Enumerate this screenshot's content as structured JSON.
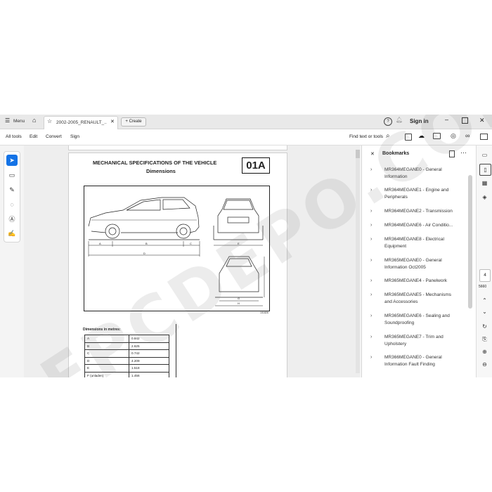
{
  "titlebar": {
    "menu_label": "Menu",
    "tab_title": "2002-2005_RENAULT_...",
    "create_label": "Create",
    "signin_label": "Sign in"
  },
  "toolbar": {
    "all_tools": "All tools",
    "edit": "Edit",
    "convert": "Convert",
    "sign": "Sign",
    "find": "Find text or tools"
  },
  "page": {
    "heading": "MECHANICAL SPECIFICATIONS OF THE VEHICLE",
    "subheading": "Dimensions",
    "section_code": "01A",
    "dim_labels": {
      "a": "A",
      "b": "B",
      "c": "C",
      "d": "D",
      "e": "E",
      "g": "G",
      "h": "H"
    },
    "drawing_ref": "101826",
    "table_title": "Dimensions in metres:",
    "table_rows": [
      {
        "label": "A",
        "value": "0.842"
      },
      {
        "label": "B",
        "value": "2.625"
      },
      {
        "label": "C",
        "value": "0.742"
      },
      {
        "label": "D",
        "value": "4.209"
      },
      {
        "label": "E",
        "value": "1.518"
      },
      {
        "label": "F (unladen)",
        "value": "1.456"
      }
    ]
  },
  "bookmarks": {
    "title": "Bookmarks",
    "items": [
      {
        "line1": "MR364MEGANE0 - General",
        "line2": "Information"
      },
      {
        "line1": "MR364MEGANE1 - Engine and",
        "line2": "Peripherals"
      },
      {
        "line1": "MR364MEGANE2 - Transmission",
        "line2": ""
      },
      {
        "line1": "MR364MEGANE6 - Air Conditio...",
        "line2": ""
      },
      {
        "line1": "MR364MEGANE8 - Electrical",
        "line2": "Equipment"
      },
      {
        "line1": "MR365MEGANE0 - General",
        "line2": "Information Oct2005"
      },
      {
        "line1": "MR365MEGANE4 - Panelwork",
        "line2": ""
      },
      {
        "line1": "MR365MEGANE5 - Mechanisms",
        "line2": "and Accessories"
      },
      {
        "line1": "MR365MEGANE6 - Sealing and",
        "line2": "Soundproofing"
      },
      {
        "line1": "MR365MEGANE7 - Trim and",
        "line2": "Upholstery"
      },
      {
        "line1": "MR366MEGANE0 - General",
        "line2": "Information Fault Finding"
      }
    ]
  },
  "navigation": {
    "current_page": "4",
    "total_pages": "5660"
  },
  "watermark": "EPCDEPO.COM"
}
